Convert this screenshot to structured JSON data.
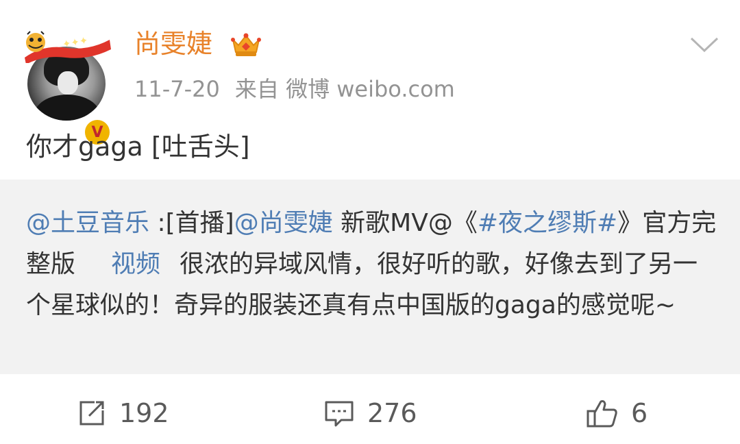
{
  "post": {
    "username": "尚雯婕",
    "date": "11-7-20",
    "source": "来自 微博 weibo.com",
    "text": "你才gaga [吐舌头]"
  },
  "repost": {
    "mention_user": "@土豆音乐",
    "text_part1": " :[首播]",
    "mention_author": "@尚雯婕",
    "text_part2": " 新歌MV@《",
    "topic": "#夜之缪斯#",
    "text_part3": "》官方完整版",
    "video_label": "视频",
    "text_part4": "很浓的异域风情，很好听的歌，好像去到了另一个星球似的！奇异的服装还真有点中国版的gaga的感觉呢~"
  },
  "actions": {
    "repost_count": "192",
    "comment_count": "276",
    "like_count": "6"
  },
  "icons": {
    "avatar_frame": "tiger-year-banner",
    "crown": "crown-icon",
    "verified": "verified-v-badge",
    "more": "chevron-down-icon",
    "repost": "share-icon",
    "comment": "comment-icon",
    "like": "thumbs-up-icon"
  },
  "colors": {
    "username": "#e8822a",
    "link": "#4f7db4",
    "meta": "#939393",
    "repost_bg": "#f2f2f2"
  }
}
